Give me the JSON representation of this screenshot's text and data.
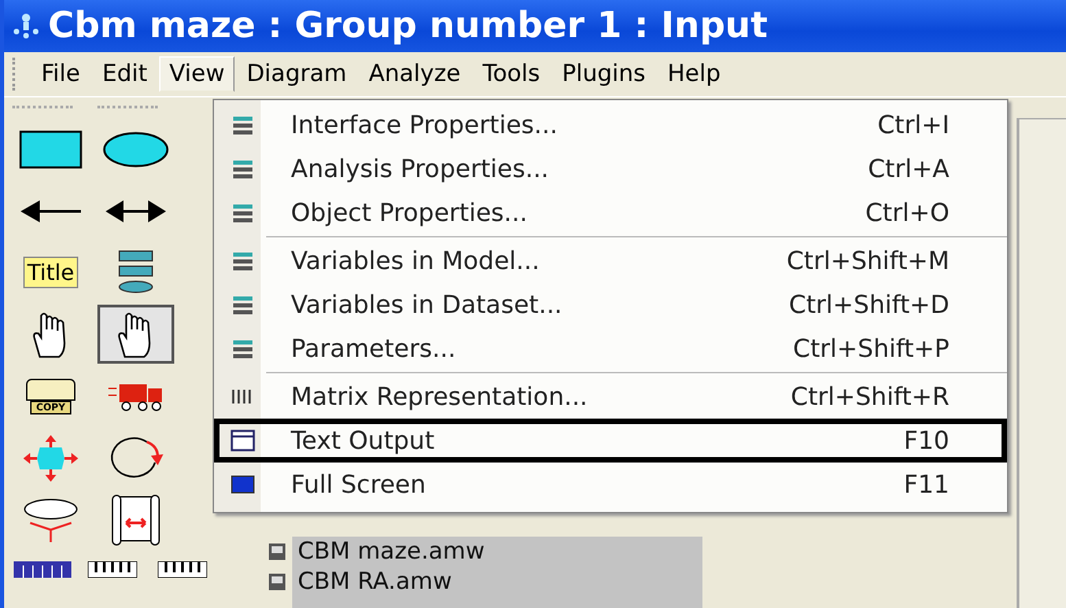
{
  "window": {
    "title": "Cbm maze : Group number 1 : Input"
  },
  "menubar": [
    {
      "label": "File",
      "selected": false
    },
    {
      "label": "Edit",
      "selected": false
    },
    {
      "label": "View",
      "selected": true
    },
    {
      "label": "Diagram",
      "selected": false
    },
    {
      "label": "Analyze",
      "selected": false
    },
    {
      "label": "Tools",
      "selected": false
    },
    {
      "label": "Plugins",
      "selected": false
    },
    {
      "label": "Help",
      "selected": false
    }
  ],
  "toolbox": [
    {
      "kind": "rectangle",
      "selected": false
    },
    {
      "kind": "ellipse",
      "selected": false
    },
    {
      "kind": "arrow-left",
      "selected": false
    },
    {
      "kind": "arrow-both",
      "selected": false
    },
    {
      "kind": "title",
      "label": "Title",
      "selected": false
    },
    {
      "kind": "list",
      "selected": false
    },
    {
      "kind": "pointer",
      "selected": false
    },
    {
      "kind": "hand",
      "selected": true
    },
    {
      "kind": "copier",
      "label": "COPY",
      "selected": false
    },
    {
      "kind": "truck",
      "selected": false
    },
    {
      "kind": "move",
      "selected": false
    },
    {
      "kind": "rotate",
      "selected": false
    },
    {
      "kind": "fork",
      "selected": false
    },
    {
      "kind": "scroll",
      "selected": false
    }
  ],
  "bottom_tools": [
    {
      "kind": "table"
    },
    {
      "kind": "keys"
    },
    {
      "kind": "keys"
    }
  ],
  "view_menu": {
    "sections": [
      [
        {
          "label": "Interface Properties...",
          "shortcut": "Ctrl+I",
          "outlined": false
        },
        {
          "label": "Analysis Properties...",
          "shortcut": "Ctrl+A",
          "outlined": false
        },
        {
          "label": "Object Properties...",
          "shortcut": "Ctrl+O",
          "outlined": false
        }
      ],
      [
        {
          "label": "Variables in Model...",
          "shortcut": "Ctrl+Shift+M",
          "outlined": false
        },
        {
          "label": "Variables in Dataset...",
          "shortcut": "Ctrl+Shift+D",
          "outlined": false
        },
        {
          "label": "Parameters...",
          "shortcut": "Ctrl+Shift+P",
          "outlined": false
        }
      ],
      [
        {
          "label": "Matrix Representation...",
          "shortcut": "Ctrl+Shift+R",
          "outlined": false
        },
        {
          "label": "Text Output",
          "shortcut": "F10",
          "outlined": true
        },
        {
          "label": "Full Screen",
          "shortcut": "F11",
          "outlined": false
        }
      ]
    ]
  },
  "files": [
    "CBM maze.amw",
    "CBM RA.amw"
  ]
}
